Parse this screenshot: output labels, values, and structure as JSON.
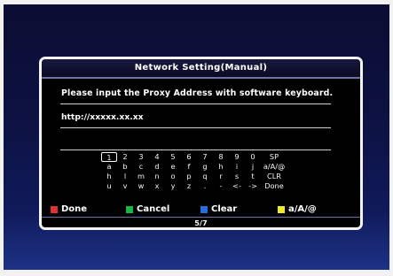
{
  "dialog": {
    "title": "Network Setting(Manual)",
    "prompt": "Please input the Proxy Address with software keyboard.",
    "input_value": "http://xxxxx.xx.xx",
    "page": "5/7"
  },
  "keyboard": {
    "selected": "1",
    "rows": [
      [
        "1",
        "2",
        "3",
        "4",
        "5",
        "6",
        "7",
        "8",
        "9",
        "0",
        "SP"
      ],
      [
        "a",
        "b",
        "c",
        "d",
        "e",
        "f",
        "g",
        "h",
        "i",
        "j",
        "a/A/@"
      ],
      [
        "h",
        "l",
        "m",
        "n",
        "o",
        "p",
        "q",
        "r",
        "s",
        "t",
        "CLR"
      ],
      [
        "u",
        "v",
        "w",
        "x",
        "y",
        "z",
        ".",
        "-",
        "<-",
        "->",
        "Done"
      ]
    ]
  },
  "footer": {
    "done": {
      "label": "Done",
      "color": "#e03232"
    },
    "cancel": {
      "label": "Cancel",
      "color": "#1db446"
    },
    "clear": {
      "label": "Clear",
      "color": "#286de0"
    },
    "case": {
      "label": "a/A/@",
      "color": "#ecec2a"
    }
  }
}
